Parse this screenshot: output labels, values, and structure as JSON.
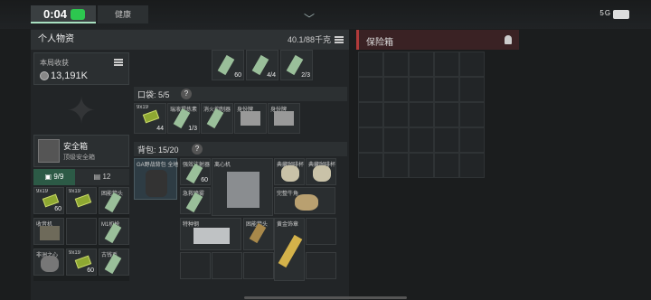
{
  "topbar": {
    "time": "0:04",
    "tab_health": "健康",
    "status": "5G 5G"
  },
  "personal": {
    "title": "个人物资",
    "weight": "40.1/88千克"
  },
  "earnings": {
    "label": "本局收获",
    "value": "13,191K"
  },
  "safebox": {
    "title": "安全箱",
    "subtitle": "顶级安全箱",
    "tab1": "9/9",
    "tab2": "12"
  },
  "top_items": [
    {
      "label": "",
      "num": "60"
    },
    {
      "label": "",
      "num": "4/4"
    },
    {
      "label": "",
      "num": "2/3"
    }
  ],
  "pocket": {
    "label": "口袋: 5/5",
    "items": [
      {
        "label": "9x19",
        "num": "44"
      },
      {
        "label": "瑞液提炼素",
        "num": "1/3"
      },
      {
        "label": "消火抑制器",
        "num": ""
      },
      {
        "label": "身份牌",
        "num": ""
      },
      {
        "label": "身份牌",
        "num": ""
      }
    ]
  },
  "backpack": {
    "label": "背包: 15/20",
    "bag_label": "GA野战背包 全地形",
    "items": [
      {
        "label": "强效注射器",
        "num": "60"
      },
      {
        "label": "离心机",
        "num": ""
      },
      {
        "label": "典藏咖啡杯",
        "num": ""
      },
      {
        "label": "典藏咖啡杯",
        "num": ""
      },
      {
        "label": "急救喷雾",
        "num": ""
      },
      {
        "label": "完整牛角",
        "num": ""
      },
      {
        "label": "特种钢",
        "num": ""
      },
      {
        "label": "困能箭头",
        "num": ""
      },
      {
        "label": "黄金饰章",
        "num": ""
      }
    ]
  },
  "safe_items": [
    {
      "label": "9x19",
      "num": "60"
    },
    {
      "label": "9x19",
      "num": ""
    },
    {
      "label": "困能箭头",
      "num": ""
    },
    {
      "label": "收音机",
      "num": ""
    },
    {
      "label": "",
      "num": ""
    },
    {
      "label": "M1机枪",
      "num": ""
    },
    {
      "label": "非洲之心",
      "num": ""
    },
    {
      "label": "9x19",
      "num": "60"
    },
    {
      "label": "古钱币",
      "num": ""
    }
  ],
  "insurance": {
    "title": "保险箱"
  }
}
